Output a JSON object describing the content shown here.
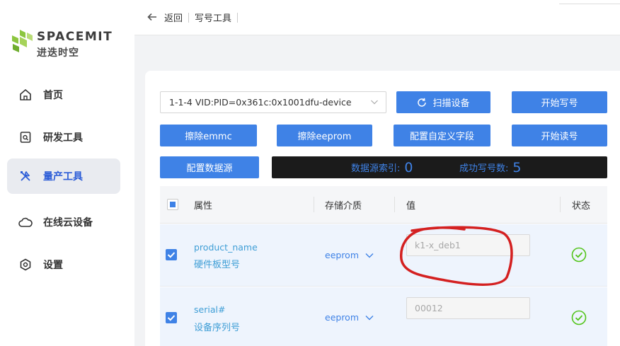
{
  "brand": {
    "name": "SPACEMIT",
    "subtitle": "进迭时空",
    "colors": {
      "primary": "#3f82e6",
      "logo_green": "#8cc63f",
      "success": "#52c41a"
    }
  },
  "sidebar": {
    "items": [
      {
        "label": "首页",
        "icon": "home-icon",
        "active": false
      },
      {
        "label": "研发工具",
        "icon": "dev-tool-icon",
        "active": false
      },
      {
        "label": "量产工具",
        "icon": "tools-icon",
        "active": true
      },
      {
        "label": "在线云设备",
        "icon": "cloud-icon",
        "active": false
      },
      {
        "label": "设置",
        "icon": "settings-icon",
        "active": false
      }
    ]
  },
  "header": {
    "back_label": "返回",
    "title": "写号工具"
  },
  "toolbar": {
    "device_select_value": "1-1-4 VID:PID=0x361c:0x1001dfu-device",
    "scan_label": "扫描设备",
    "start_write_label": "开始写号",
    "erase_emmc_label": "擦除emmc",
    "erase_eeprom_label": "擦除eeprom",
    "config_custom_field_label": "配置自定义字段",
    "start_read_label": "开始读号",
    "config_datasource_label": "配置数据源"
  },
  "status": {
    "datasource_index_label": "数据源索引:",
    "datasource_index_value": "0",
    "success_count_label": "成功写号数:",
    "success_count_value": "5"
  },
  "table": {
    "headers": {
      "attribute": "属性",
      "medium": "存储介质",
      "value": "值",
      "state": "状态"
    },
    "rows": [
      {
        "name": "product_name",
        "desc": "硬件板型号",
        "medium": "eeprom",
        "value": "k1-x_deb1",
        "checked": true,
        "state": "success"
      },
      {
        "name": "serial#",
        "desc": "设备序列号",
        "medium": "eeprom",
        "value": "00012",
        "checked": true,
        "state": "success"
      }
    ]
  },
  "annotation": {
    "color": "#d42020"
  }
}
